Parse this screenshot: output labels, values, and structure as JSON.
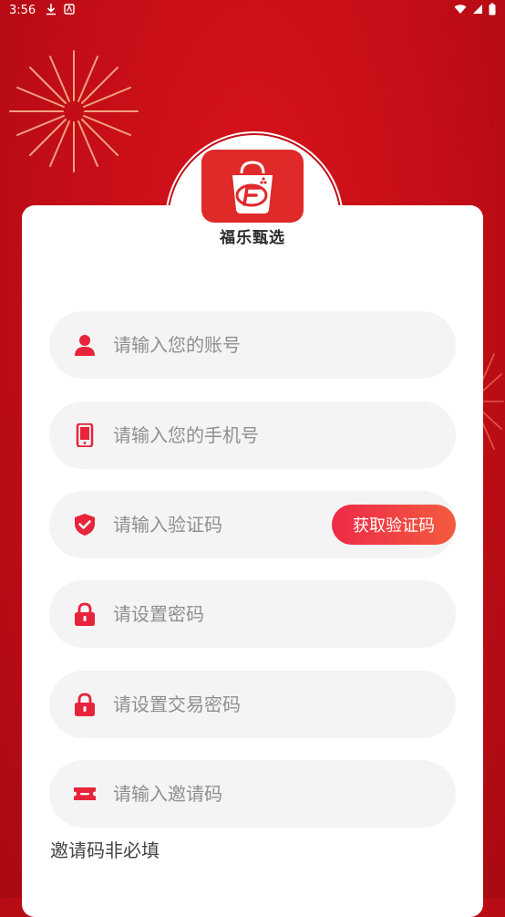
{
  "status_bar": {
    "time": "3:56"
  },
  "logo": {
    "name": "福乐甄选"
  },
  "form": {
    "account": {
      "placeholder": "请输入您的账号",
      "value": ""
    },
    "phone": {
      "placeholder": "请输入您的手机号",
      "value": ""
    },
    "code": {
      "placeholder": "请输入验证码",
      "value": ""
    },
    "get_code_label": "获取验证码",
    "password": {
      "placeholder": "请设置密码",
      "value": ""
    },
    "trade_password": {
      "placeholder": "请设置交易密码",
      "value": ""
    },
    "invite": {
      "placeholder": "请输入邀请码",
      "value": ""
    },
    "invite_note": "邀请码非必填"
  },
  "colors": {
    "background": "#c30d17",
    "accent": "#e8243a",
    "button_gradient_start": "#ee2a48",
    "button_gradient_end": "#f35b3f"
  },
  "icons": {
    "account": "user-icon",
    "phone": "phone-icon",
    "code": "shield-check-icon",
    "password": "lock-icon",
    "trade_password": "lock-icon",
    "invite": "ticket-icon"
  }
}
